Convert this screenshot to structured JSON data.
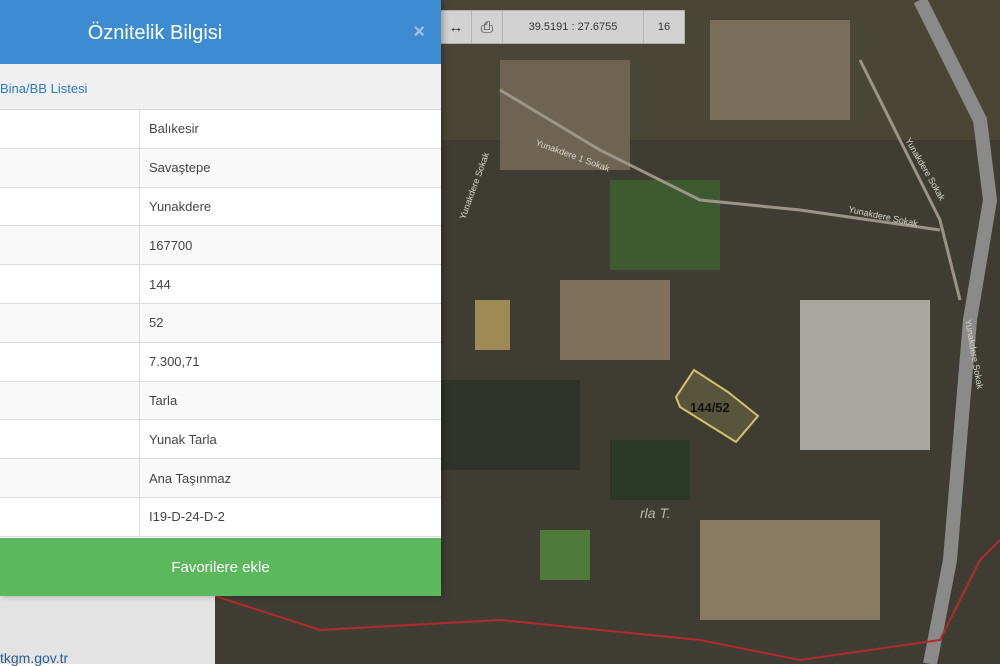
{
  "map": {
    "parcel_label": "144/52",
    "area_label": "rla T.",
    "street_labels": [
      "Yunakdere 1 Sokak",
      "Yunakdere Sokak",
      "Yunakdere Sokak",
      "Yunakdere Sokak",
      "Yunakdere Sokak"
    ]
  },
  "toolbar": {
    "measure_icon": "horizontal-arrows-icon",
    "print_icon": "printer-icon",
    "coordinates": "39.5191 : 27.6755",
    "zoom_level": "16"
  },
  "panel": {
    "title": "Öznitelik Bilgisi",
    "close_icon": "×",
    "link": "Bina/BB Listesi",
    "rows": [
      {
        "value": "Balıkesir"
      },
      {
        "value": "Savaştepe"
      },
      {
        "value": "Yunakdere"
      },
      {
        "value": "167700"
      },
      {
        "value": "144"
      },
      {
        "value": "52"
      },
      {
        "value": "7.300,71"
      },
      {
        "value": "Tarla"
      },
      {
        "value": "Yunak Tarla"
      },
      {
        "value": "Ana Taşınmaz"
      },
      {
        "value": "I19-D-24-D-2"
      }
    ],
    "favorite_button": "Favorilere ekle"
  },
  "footer": {
    "link": "tkgm.gov.tr"
  },
  "colors": {
    "header": "#3d8bd0",
    "button": "#5cb85c",
    "parcel_outline": "#d4c36a",
    "boundary_line": "#b22a2a"
  }
}
